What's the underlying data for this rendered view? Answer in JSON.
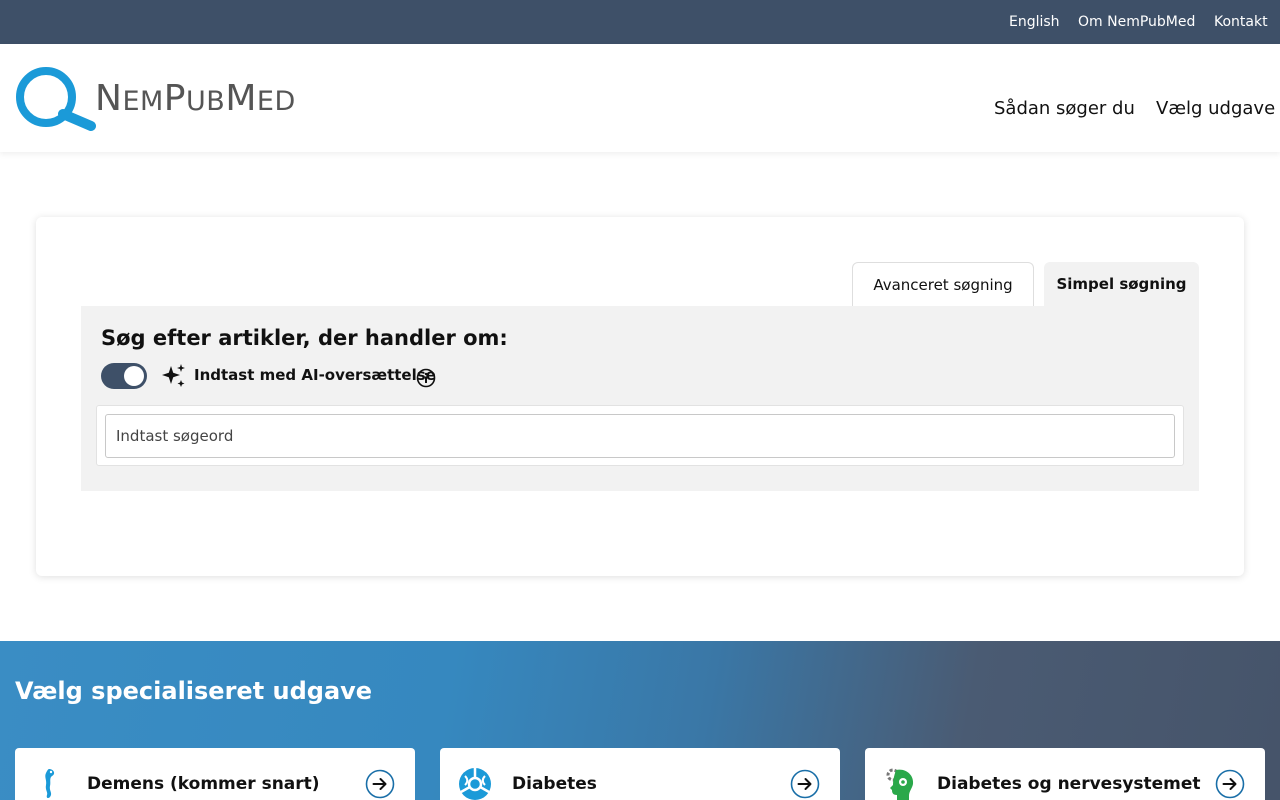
{
  "topbar": {
    "links": [
      "English",
      "Om NemPubMed",
      "Kontakt"
    ]
  },
  "header": {
    "logo_text": "NemPubMed",
    "nav": [
      "Sådan søger du",
      "Vælg udgave"
    ]
  },
  "search": {
    "tabs": [
      "Avanceret søgning",
      "Simpel søgning"
    ],
    "active_tab": "Simpel søgning",
    "title": "Søg efter artikler, der handler om:",
    "ai_toggle_label": "Indtast med AI-oversættelse",
    "ai_toggle_on": true,
    "placeholder": "Indtast søgeord",
    "value": ""
  },
  "editions": {
    "title": "Vælg specialiseret udgave",
    "items": [
      {
        "label": "Demens (kommer snart)",
        "icon": "seahorse-brain-icon"
      },
      {
        "label": "Diabetes",
        "icon": "diabetes-circle-icon"
      },
      {
        "label": "Diabetes og nervesystemet",
        "icon": "head-gear-icon"
      }
    ]
  },
  "colors": {
    "topbar": "#3e5068",
    "brand_blue": "#1b9ad8",
    "panel_bg": "#f2f2f2",
    "toggle_on": "#3e5068"
  }
}
